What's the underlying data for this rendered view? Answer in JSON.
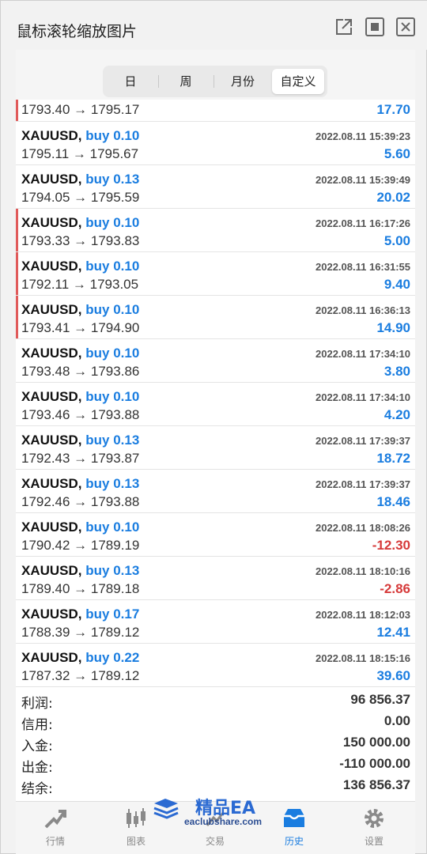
{
  "window": {
    "title": "鼠标滚轮缩放图片",
    "buttons": [
      "external-link-icon",
      "maximize-icon",
      "close-icon"
    ]
  },
  "period_tabs": [
    {
      "label": "日",
      "active": false
    },
    {
      "label": "周",
      "active": false
    },
    {
      "label": "月份",
      "active": false
    },
    {
      "label": "自定义",
      "active": true
    }
  ],
  "first_row": {
    "prices": "1793.40 → 1795.17",
    "profit": "17.70",
    "marked": true
  },
  "trades": [
    {
      "symbol": "XAUUSD,",
      "side": "buy 0.10",
      "time": "2022.08.11 15:39:23",
      "prices": "1795.11 → 1795.67",
      "profit": "5.60",
      "negative": false,
      "marked": false
    },
    {
      "symbol": "XAUUSD,",
      "side": "buy 0.13",
      "time": "2022.08.11 15:39:49",
      "prices": "1794.05 → 1795.59",
      "profit": "20.02",
      "negative": false,
      "marked": false
    },
    {
      "symbol": "XAUUSD,",
      "side": "buy 0.10",
      "time": "2022.08.11 16:17:26",
      "prices": "1793.33 → 1793.83",
      "profit": "5.00",
      "negative": false,
      "marked": true
    },
    {
      "symbol": "XAUUSD,",
      "side": "buy 0.10",
      "time": "2022.08.11 16:31:55",
      "prices": "1792.11 → 1793.05",
      "profit": "9.40",
      "negative": false,
      "marked": true
    },
    {
      "symbol": "XAUUSD,",
      "side": "buy 0.10",
      "time": "2022.08.11 16:36:13",
      "prices": "1793.41 → 1794.90",
      "profit": "14.90",
      "negative": false,
      "marked": true
    },
    {
      "symbol": "XAUUSD,",
      "side": "buy 0.10",
      "time": "2022.08.11 17:34:10",
      "prices": "1793.48 → 1793.86",
      "profit": "3.80",
      "negative": false,
      "marked": false
    },
    {
      "symbol": "XAUUSD,",
      "side": "buy 0.10",
      "time": "2022.08.11 17:34:10",
      "prices": "1793.46 → 1793.88",
      "profit": "4.20",
      "negative": false,
      "marked": false
    },
    {
      "symbol": "XAUUSD,",
      "side": "buy 0.13",
      "time": "2022.08.11 17:39:37",
      "prices": "1792.43 → 1793.87",
      "profit": "18.72",
      "negative": false,
      "marked": false
    },
    {
      "symbol": "XAUUSD,",
      "side": "buy 0.13",
      "time": "2022.08.11 17:39:37",
      "prices": "1792.46 → 1793.88",
      "profit": "18.46",
      "negative": false,
      "marked": false
    },
    {
      "symbol": "XAUUSD,",
      "side": "buy 0.10",
      "time": "2022.08.11 18:08:26",
      "prices": "1790.42 → 1789.19",
      "profit": "-12.30",
      "negative": true,
      "marked": false
    },
    {
      "symbol": "XAUUSD,",
      "side": "buy 0.13",
      "time": "2022.08.11 18:10:16",
      "prices": "1789.40 → 1789.18",
      "profit": "-2.86",
      "negative": true,
      "marked": false
    },
    {
      "symbol": "XAUUSD,",
      "side": "buy 0.17",
      "time": "2022.08.11 18:12:03",
      "prices": "1788.39 → 1789.12",
      "profit": "12.41",
      "negative": false,
      "marked": false
    },
    {
      "symbol": "XAUUSD,",
      "side": "buy 0.22",
      "time": "2022.08.11 18:15:16",
      "prices": "1787.32 → 1789.12",
      "profit": "39.60",
      "negative": false,
      "marked": false
    }
  ],
  "summary": [
    {
      "label": "利润:",
      "value": "96 856.37"
    },
    {
      "label": "信用:",
      "value": "0.00"
    },
    {
      "label": "入金:",
      "value": "150 000.00"
    },
    {
      "label": "出金:",
      "value": "-110 000.00"
    },
    {
      "label": "结余:",
      "value": "136 856.37"
    }
  ],
  "bottom_tabs": [
    {
      "label": "行情",
      "icon": "quotes-icon",
      "active": false
    },
    {
      "label": "图表",
      "icon": "chart-icon",
      "active": false
    },
    {
      "label": "交易",
      "icon": "trade-icon",
      "active": false
    },
    {
      "label": "历史",
      "icon": "history-icon",
      "active": true
    },
    {
      "label": "设置",
      "icon": "settings-icon",
      "active": false
    }
  ],
  "watermark": {
    "brand": "精品EA",
    "site": "eaclubshare.com"
  },
  "colors": {
    "accent": "#1a7de0",
    "negative": "#d63a3a",
    "marker": "#e05a5a"
  }
}
